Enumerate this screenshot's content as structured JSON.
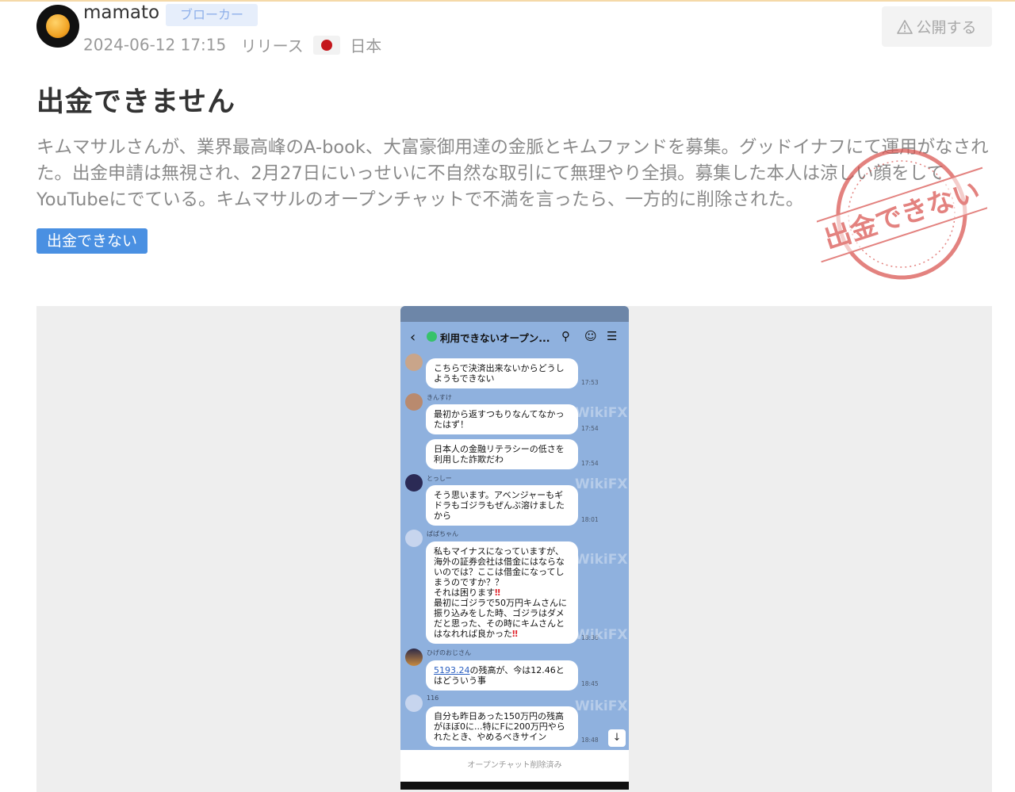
{
  "post": {
    "username": "mamato",
    "badge": "ブローカー",
    "datetime": "2024-06-12 17:15",
    "status": "リリース",
    "country": "日本",
    "publish_label": "公開する",
    "title": "出金できません",
    "description": "キムマサルさんが、業界最高峰のA-book、大富豪御用達の金脈とキムファンドを募集。グッドイナフにて運用がなされた。出金申請は無視され、2月27日にいっせいに不自然な取引にて無理やり全損。募集した本人は涼しい顔をしてYouTubeにでている。キムマサルのオープンチャットで不満を言ったら、一方的に削除された。",
    "tag": "出金できない",
    "stamp_text": "出金できない"
  },
  "colors": {
    "accent": "#4a90e2",
    "stamp": "#d9534f",
    "chat_bg": "#8fb1de"
  },
  "chat": {
    "header_title": "利用できないオープン...",
    "deleted_notice": "オープンチャット削除済み",
    "watermark": "WikiFX",
    "messages": [
      {
        "sender": "",
        "text": "こちらで決済出来ないからどうしようもできない",
        "time": "17:53"
      },
      {
        "sender": "きんすけ",
        "text": "最初から返すつもりなんてなかったはず！",
        "time": "17:54"
      },
      {
        "sender": "",
        "text": "日本人の金融リテラシーの低さを利用した詐欺だわ",
        "time": "17:54"
      },
      {
        "sender": "とっしー",
        "text": "そう思います。アベンジャーもギドラもゴジラもぜんぶ溶けましたから",
        "time": "18:01"
      },
      {
        "sender": "ぱぱちゃん",
        "text_lines": [
          "私もマイナスになっていますが、海外の証券会社は借金にはならないのでは？ここは借金になってしまうのですか？？",
          "それは困ります",
          "最初にゴジラで50万円キムさんに振り込みをした時、ゴジラはダメだと思った、その時にキムさんとはなれれば良かった"
        ],
        "time": "18:36"
      },
      {
        "sender": "ひげのおじさん",
        "link": "5193.24",
        "text": "の残高が、今は12.46とはどういう事",
        "time": "18:45"
      },
      {
        "sender": "116",
        "text": "自分も昨日あった150万円の残高がほぼ0に...特にFに200万円やられたとき、やめるべきサイン",
        "time": "18:48"
      }
    ]
  }
}
